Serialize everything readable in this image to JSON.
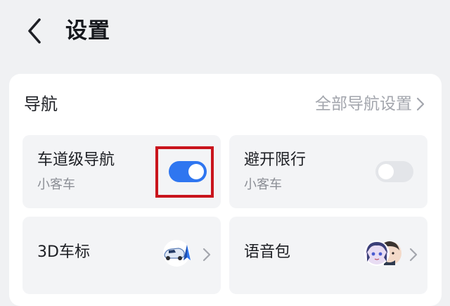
{
  "header": {
    "title": "设置",
    "back_icon": "chevron-left-icon"
  },
  "navigation": {
    "section_title": "导航",
    "all_settings_label": "全部导航设置",
    "tiles": [
      {
        "title": "车道级导航",
        "subtitle": "小客车",
        "control": "toggle",
        "enabled": true
      },
      {
        "title": "避开限行",
        "subtitle": "小客车",
        "control": "toggle",
        "enabled": false
      },
      {
        "title": "3D车标",
        "control": "link",
        "icon": "car-model-icon"
      },
      {
        "title": "语音包",
        "control": "link",
        "icon": "voice-avatars-icon"
      }
    ]
  },
  "colors": {
    "accent": "#2f76f0",
    "highlight": "#c9141c",
    "background": "#f0f1f3",
    "card": "#ffffff",
    "tile": "#f3f4f6"
  }
}
